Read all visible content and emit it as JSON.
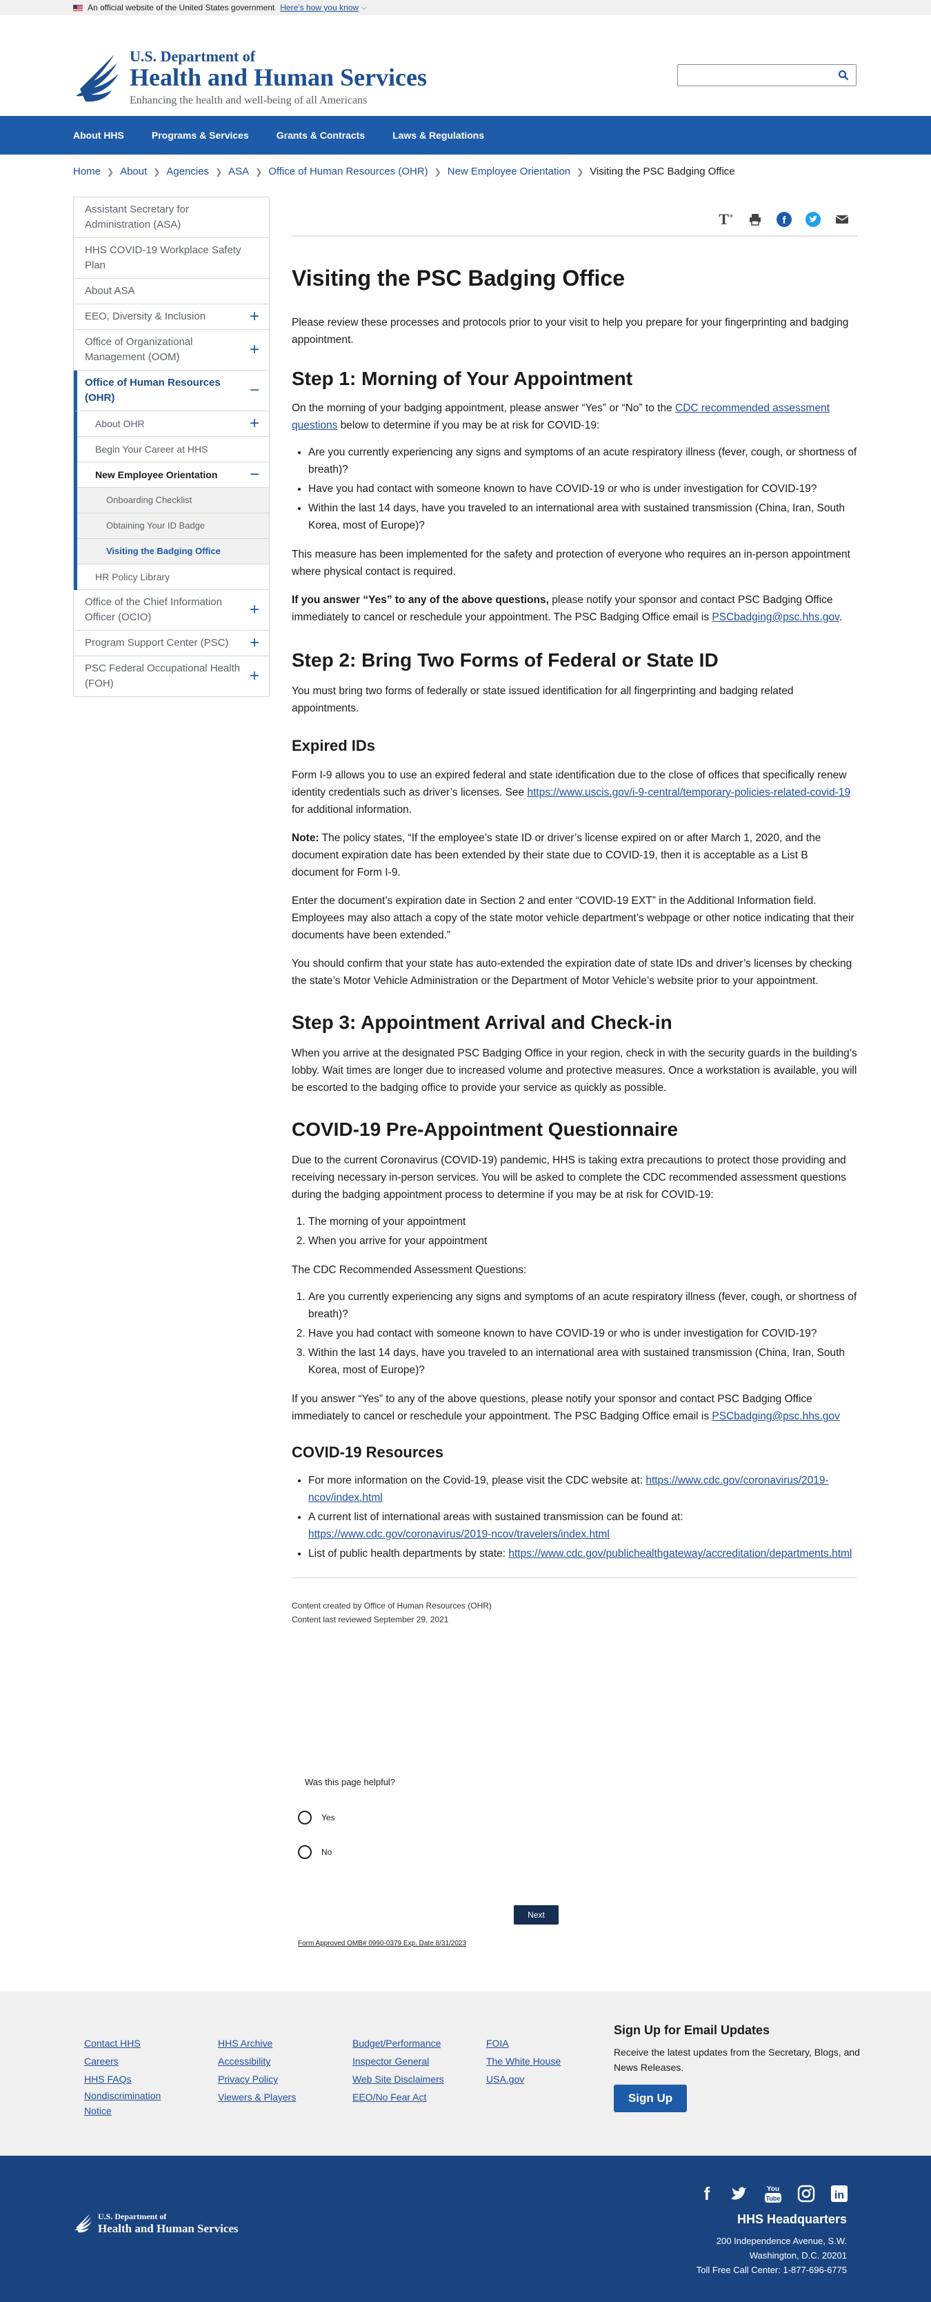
{
  "gov_banner": {
    "text": "An official website of the United States government",
    "link": "Here’s how you know"
  },
  "header": {
    "dept_line1": "U.S. Department of",
    "dept_line2": "Health and Human Services",
    "tagline": "Enhancing the health and well-being of all Americans",
    "search_placeholder": ""
  },
  "nav": [
    "About HHS",
    "Programs & Services",
    "Grants & Contracts",
    "Laws & Regulations"
  ],
  "breadcrumb": [
    "Home",
    "About",
    "Agencies",
    "ASA",
    "Office of Human Resources (OHR)",
    "New Employee Orientation",
    "Visiting the PSC Badging Office"
  ],
  "sidebar": {
    "items": [
      "Assistant Secretary for Administration (ASA)",
      "HHS COVID-19 Workplace Safety Plan",
      "About ASA",
      "EEO, Diversity & Inclusion",
      "Office of Organizational Management (OOM)",
      "Office of Human Resources (OHR)"
    ],
    "ohr_sub": [
      "About OHR",
      "Begin Your Career at HHS",
      "New Employee Orientation"
    ],
    "neo_sub": [
      "Onboarding Checklist",
      "Obtaining Your ID Badge",
      "Visiting the Badging Office"
    ],
    "ohr_after": "HR Policy Library",
    "items_after": [
      "Office of the Chief Information Officer (OCIO)",
      "Program Support Center (PSC)",
      "PSC Federal Occupational Health (FOH)"
    ]
  },
  "share_icons": [
    "text-size-icon",
    "print-icon",
    "facebook-icon",
    "twitter-icon",
    "email-icon"
  ],
  "content": {
    "title": "Visiting the PSC Badging Office",
    "intro": "Please review these processes and protocols prior to your visit to help you prepare for your fingerprinting and badging appointment.",
    "step1_heading": "Step 1: Morning of Your Appointment",
    "step1_p1_a": "On the morning of your badging appointment, please answer “Yes” or “No” to the ",
    "step1_p1_link": "CDC recommended assessment questions",
    "step1_p1_b": " below to determine if you may be at risk for COVID-19:",
    "questions": [
      "Are you currently experiencing any signs and symptoms of an acute respiratory illness (fever, cough, or shortness of breath)?",
      "Have you had contact with someone known to have COVID-19 or who is under investigation for COVID-19?",
      "Within the last 14 days, have you traveled to an international area with sustained transmission (China, Iran, South Korea, most of Europe)?"
    ],
    "step1_p2": "This measure has been implemented for the safety and protection of everyone who requires an in-person appointment where physical contact is required.",
    "step1_p3_bold": "If you answer “Yes” to any of the above questions,",
    "step1_p3": " please notify your sponsor and contact PSC Badging Office immediately to cancel or reschedule your appointment. The PSC Badging Office email is ",
    "email": "PSCbadging@psc.hhs.gov",
    "step2_heading": "Step 2: Bring Two Forms of Federal or State ID",
    "step2_p": "You must bring two forms of federally or state issued identification for all fingerprinting and badging related appointments.",
    "expired_heading": "Expired IDs",
    "expired_p1_a": "Form I-9 allows you to use an expired federal and state identification due to the close of offices that specifically renew identity credentials such as driver’s licenses.  See ",
    "expired_p1_link": "https://www.uscis.gov/i-9-central/temporary-policies-related-covid-19",
    "expired_p1_b": " for additional information.",
    "note_label": "Note:",
    "note_text": " The policy states, “If the employee’s state ID or driver’s license expired on or after March 1, 2020, and the document expiration date has been extended by their state due to COVID-19, then it is acceptable as a List B document for Form I-9.",
    "expired_p3": "Enter the document’s expiration date in Section 2 and enter “COVID-19 EXT” in the Additional Information field. Employees may also attach a copy of the state motor vehicle department’s webpage or other notice indicating that their documents have been extended.”",
    "expired_p4": "You should confirm that your state has auto-extended the expiration date of state IDs and driver’s licenses by checking the state’s Motor Vehicle Administration or the Department of Motor Vehicle’s website prior to your appointment.",
    "step3_heading": "Step 3: Appointment Arrival and Check-in",
    "step3_p": "When you arrive at the designated PSC Badging Office in your region, check in with the security guards in the building’s lobby. Wait times are longer due to increased volume and protective measures.  Once a workstation is available, you will be escorted to the badging office to provide your service as quickly as possible.",
    "q_heading": "COVID-19 Pre-Appointment Questionnaire",
    "q_p1": "Due to the current Coronavirus (COVID-19) pandemic, HHS is taking extra precautions to protect those providing and receiving necessary in-person services.  You will be asked to complete the CDC recommended assessment questions during the badging appointment process to determine if you may be at risk for COVID-19:",
    "q_times": [
      "The morning of your appointment",
      "When you arrive for your appointment"
    ],
    "q_p2": "The CDC Recommended Assessment Questions:",
    "q_p3": "If you answer “Yes” to any of the above questions, please notify your sponsor and contact PSC Badging Office immediately to cancel or reschedule your appointment. The PSC Badging Office email is ",
    "res_heading": "COVID-19 Resources",
    "res1_a": "For more information on the Covid-19, please visit the CDC website at: ",
    "res1_link": "https://www.cdc.gov/coronavirus/2019-ncov/index.html",
    "res2_a": "A current list of international areas with sustained transmission can be found at: ",
    "res2_link": "https://www.cdc.gov/coronavirus/2019-ncov/travelers/index.html",
    "res3_a": "List of public health departments by state: ",
    "res3_link": "https://www.cdc.gov/publichealthgateway/accreditation/departments.html",
    "created": "Content created by Office of Human Resources (OHR)",
    "reviewed": "Content last reviewed September 29, 2021"
  },
  "survey": {
    "question": "Was this page helpful?",
    "yes": "Yes",
    "no": "No",
    "next": "Next",
    "omb": "Form Approved OMB# 0990-0379 Exp. Date 8/31/2023"
  },
  "footer": {
    "col1": [
      "Contact HHS",
      "Careers",
      "HHS FAQs",
      "Nondiscrimination Notice"
    ],
    "col2": [
      "HHS Archive",
      "Accessibility",
      "Privacy Policy",
      "Viewers & Players"
    ],
    "col3": [
      "Budget/Performance",
      "Inspector General",
      "Web Site Disclaimers",
      "EEO/No Fear Act"
    ],
    "col4": [
      "FOIA",
      "The White House",
      "USA.gov"
    ],
    "signup_title": "Sign Up for Email Updates",
    "signup_desc": "Receive the latest updates from the Secretary, Blogs, and News Releases.",
    "signup_btn": "Sign Up"
  },
  "bottom": {
    "hq_title": "HHS Headquarters",
    "address1": "200 Independence Avenue, S.W.",
    "address2": "Washington, D.C. 20201",
    "phone": "Toll Free Call Center: 1-877-696-6775",
    "logo_l1": "U.S. Department of",
    "logo_l2": "Health and Human Services",
    "social_icons": [
      "facebook-icon",
      "twitter-icon",
      "youtube-icon",
      "instagram-icon",
      "linkedin-icon"
    ]
  }
}
